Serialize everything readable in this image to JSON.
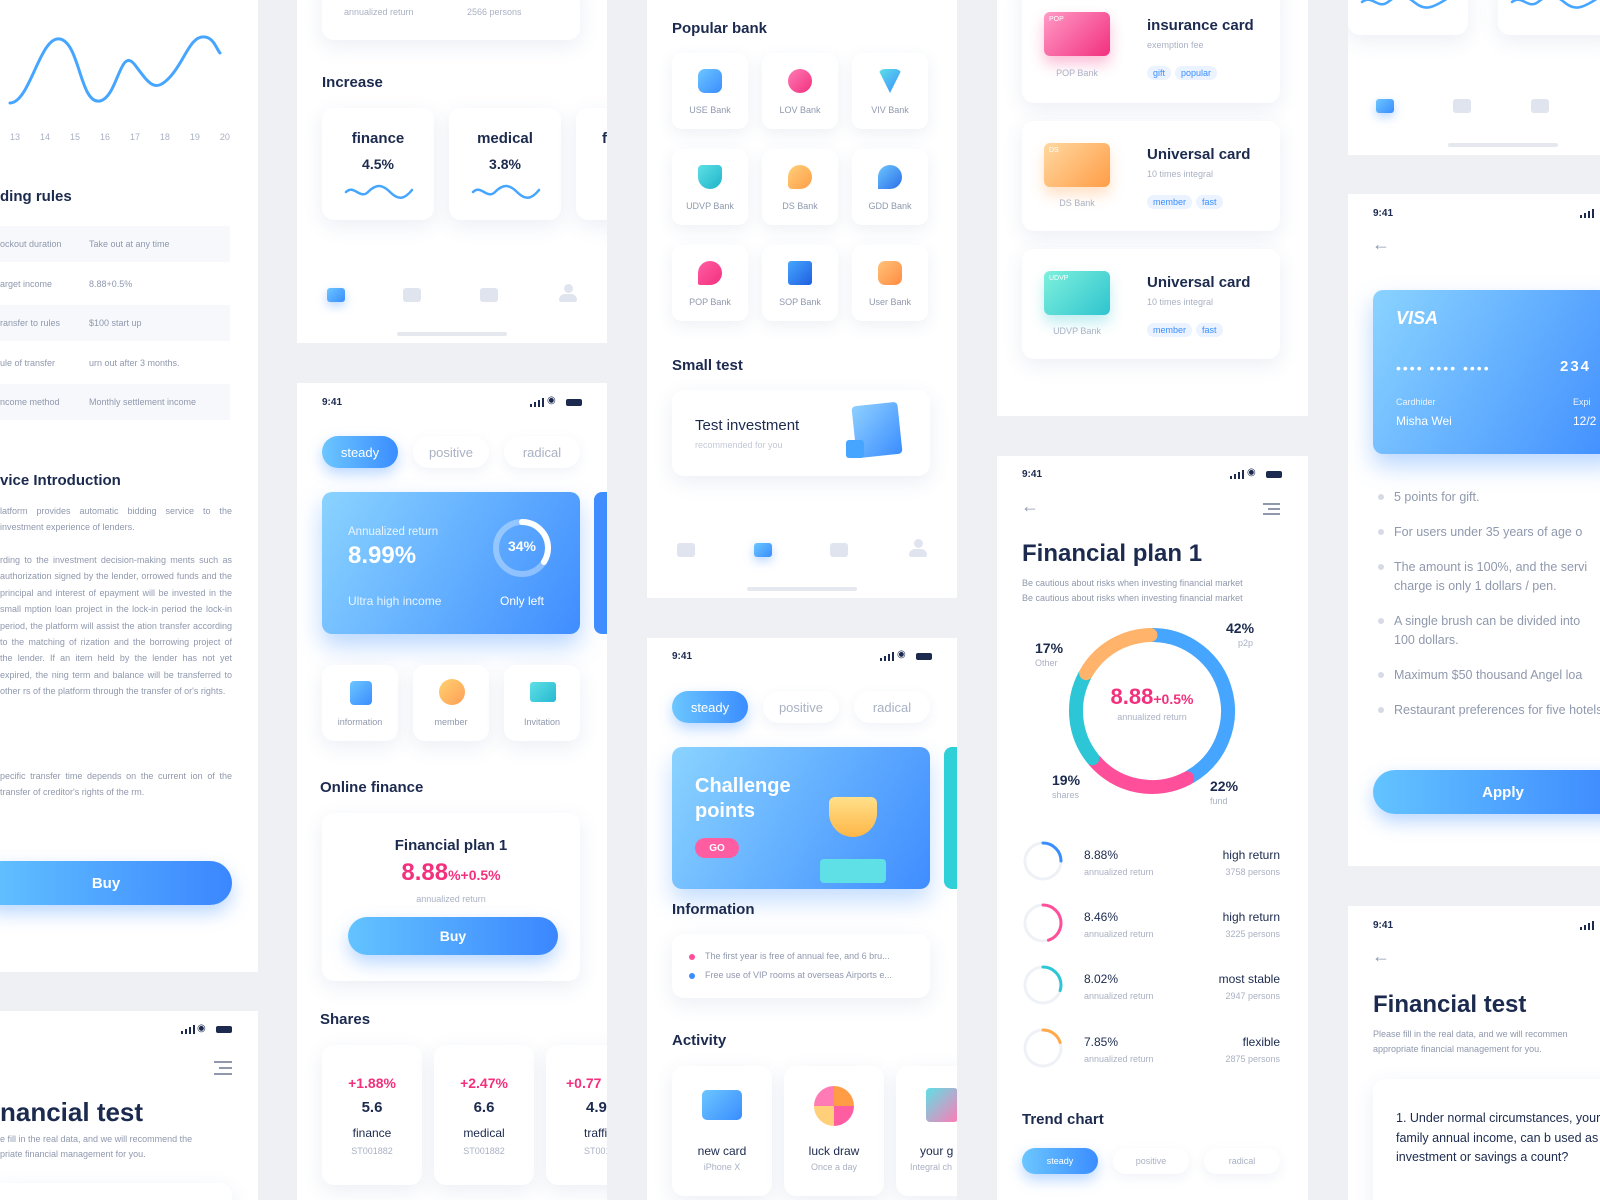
{
  "status_time": "9:41",
  "screen_a": {
    "chart_ticks": [
      "13",
      "14",
      "15",
      "16",
      "17",
      "18",
      "19",
      "20"
    ],
    "rules_title": "ding rules",
    "rules": [
      {
        "k": "ockout duration",
        "v": "Take out at any time"
      },
      {
        "k": "arget income",
        "v": "8.88+0.5%"
      },
      {
        "k": "ransfer to rules",
        "v": "$100 start up"
      },
      {
        "k": "ule of transfer",
        "v": "urn out after 3 months."
      },
      {
        "k": "ncome method",
        "v": "Monthly settlement income"
      }
    ],
    "intro_title": "vice Introduction",
    "para1": "latform provides automatic bidding service to the investment experience of lenders.",
    "para2": "rding to the investment decision-making ments such as authorization signed by the lender, orrowed funds and the principal and interest of epayment will be invested in the small mption loan project in the lock-in period the lock-in period, the platform will assist the ation transfer according to the matching of rization and the borrowing project of the lender. If an item held by the lender has not yet expired, the ning term and balance will be transferred to other rs of the platform through the transfer of or's rights.",
    "para3": "pecific transfer time depends on the current ion of the transfer of creditor's rights of the rm.",
    "buy": "Buy"
  },
  "screen_a2": {
    "title": "nancial test",
    "desc1": "e fill in the real data, and we will recommend the",
    "desc2": "priate financial management for you."
  },
  "screen_b": {
    "top_left": "annualized return",
    "top_right": "2566 persons",
    "increase_title": "Increase",
    "increase": [
      {
        "name": "finance",
        "rate": "4.5%"
      },
      {
        "name": "medical",
        "rate": "3.8%"
      },
      {
        "name": "f",
        "rate": ""
      }
    ]
  },
  "screen_c": {
    "tabs": [
      "steady",
      "positive",
      "radical"
    ],
    "hero_label": "Annualized return",
    "hero_value": "8.99%",
    "hero_sub": "Ultra high income",
    "donut_value": "34%",
    "donut_sub": "Only left",
    "donut_fraction": 0.34,
    "quick": [
      "information",
      "member",
      "Invitation"
    ],
    "online_title": "Online finance",
    "plan_title": "Financial plan 1",
    "plan_rate": "8.88",
    "plan_rate_suffix": "%+0.5%",
    "plan_sub": "annualized return",
    "buy": "Buy",
    "shares_title": "Shares",
    "shares": [
      {
        "pct": "+1.88%",
        "val": "5.6",
        "name": "finance",
        "code": "ST001882"
      },
      {
        "pct": "+2.47%",
        "val": "6.6",
        "name": "medical",
        "code": "ST001882"
      },
      {
        "pct": "+0.77",
        "val": "4.9",
        "name": "traffi",
        "code": "ST0018"
      }
    ]
  },
  "screen_d": {
    "popular_title": "Popular bank",
    "banks": [
      "USE Bank",
      "LOV Bank",
      "VIV Bank",
      "UDVP Bank",
      "DS Bank",
      "GDD Bank",
      "POP Bank",
      "SOP Bank",
      "User Bank"
    ],
    "small_title": "Small test",
    "test_title": "Test investment",
    "test_sub": "recommended for you"
  },
  "screen_e": {
    "tabs": [
      "steady",
      "positive",
      "radical"
    ],
    "banner_title_1": "Challenge",
    "banner_title_2": "points",
    "banner_go": "GO",
    "info_title": "Information",
    "info": [
      "The first year is free of annual fee, and 6 bru...",
      "Free use of VIP rooms at overseas Airports e..."
    ],
    "activity_title": "Activity",
    "activities": [
      {
        "name": "new card",
        "sub": "iPhone X"
      },
      {
        "name": "luck draw",
        "sub": "Once a day"
      },
      {
        "name": "your g",
        "sub": "Integral ch"
      }
    ]
  },
  "screen_f": {
    "cards": [
      {
        "bank": "POP Bank",
        "chip": "POP",
        "title": "insurance card",
        "sub": "exemption fee",
        "tags": [
          "gift",
          "popular"
        ]
      },
      {
        "bank": "DS Bank",
        "chip": "DS",
        "title": "Universal card",
        "sub": "10 times integral",
        "tags": [
          "member",
          "fast"
        ]
      },
      {
        "bank": "UDVP Bank",
        "chip": "UDVP",
        "title": "Universal card",
        "sub": "10 times integral",
        "tags": [
          "member",
          "fast"
        ]
      }
    ]
  },
  "screen_g": {
    "title": "Financial plan 1",
    "desc1": "Be cautious about risks when investing financial market",
    "desc2": "Be cautious about risks when investing financial market",
    "center_value": "8.88",
    "center_suffix": "+0.5%",
    "center_sub": "annualized return",
    "chart_data": {
      "type": "pie",
      "categories": [
        "Other",
        "p2p",
        "shares",
        "fund"
      ],
      "values": [
        17,
        42,
        19,
        22
      ],
      "labels": [
        "17%",
        "42%",
        "19%",
        "22%"
      ]
    },
    "plans": [
      {
        "rate": "8.88%",
        "sub": "annualized return",
        "kind": "high return",
        "persons": "3758 persons",
        "fill": 0.25,
        "color": "#3a8dff"
      },
      {
        "rate": "8.46%",
        "sub": "annualized return",
        "kind": "high return",
        "persons": "3225 persons",
        "fill": 0.45,
        "color": "#ff4f9a"
      },
      {
        "rate": "8.02%",
        "sub": "annualized return",
        "kind": "most stable",
        "persons": "2947 persons",
        "fill": 0.3,
        "color": "#2cc6d6"
      },
      {
        "rate": "7.85%",
        "sub": "annualized return",
        "kind": "flexible",
        "persons": "2875 persons",
        "fill": 0.2,
        "color": "#ffa94d"
      }
    ],
    "trend_title": "Trend chart",
    "tabs": [
      "steady",
      "positive",
      "radical"
    ]
  },
  "screen_h": {
    "card_brand": "VISA",
    "card_dots": "••••   ••••   ••••",
    "card_last": "234",
    "holder_label": "Cardhider",
    "holder_name": "Misha Wei",
    "exp_label": "Expi",
    "exp_value": "12/2",
    "bullets": [
      "5 points for gift.",
      "For users under 35 years of age o",
      "The amount is 100%, and the servi charge is only 1 dollars / pen.",
      "A single brush can be divided into 100 dollars.",
      "Maximum $50 thousand Angel loa",
      "Restaurant preferences for five hotels"
    ],
    "apply": "Apply"
  },
  "screen_i": {
    "title": "Financial test",
    "desc1": "Please fill in the real data, and we will recommen",
    "desc2": "appropriate financial management for you.",
    "question": "1. Under normal circumstances, your family annual income, can b used as investment or savings a count?"
  }
}
